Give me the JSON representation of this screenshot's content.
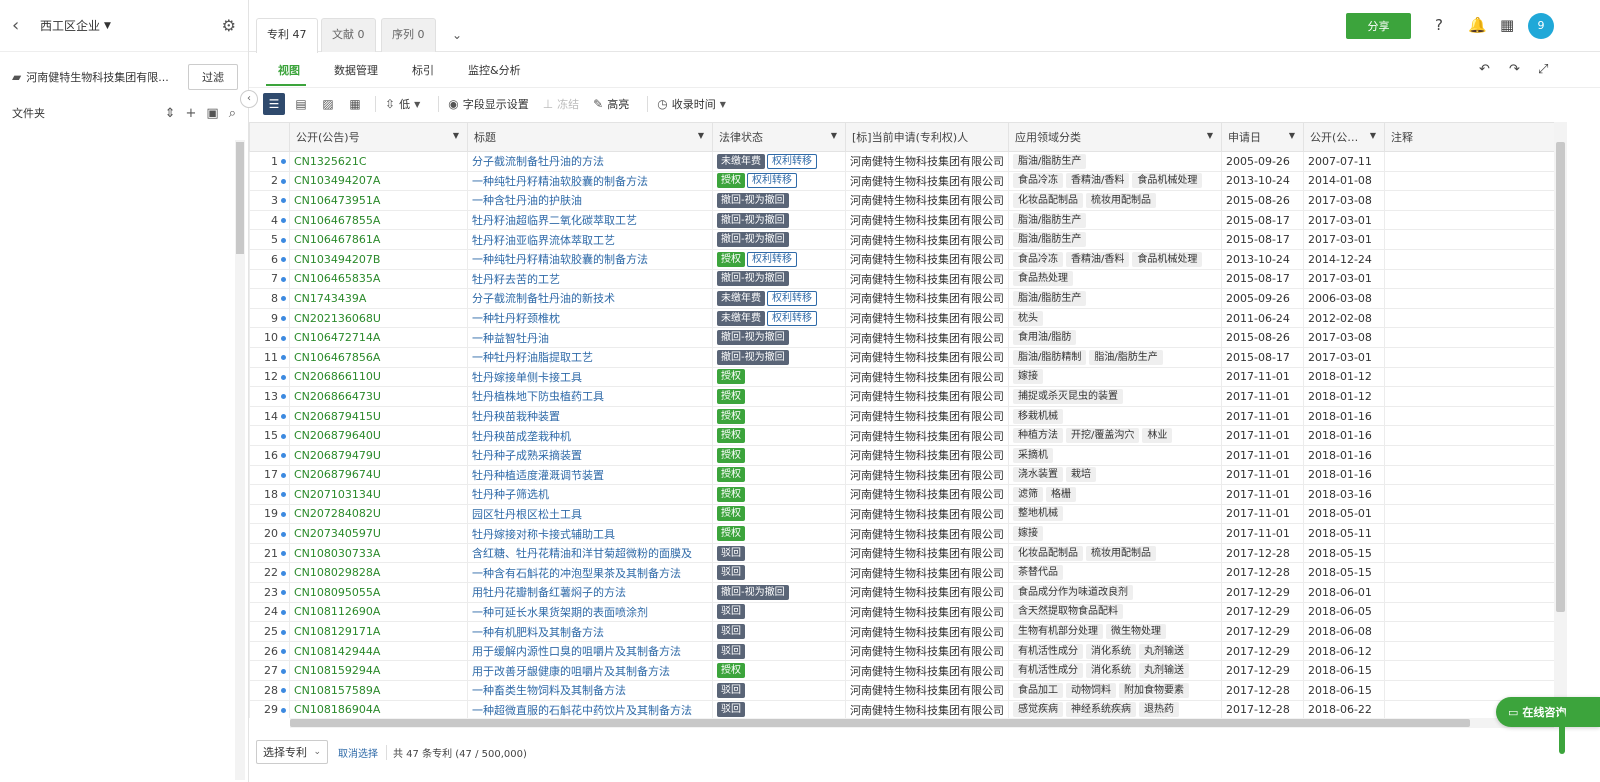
{
  "sidebar": {
    "workspace": "西工区企业",
    "project_name": "河南健特生物科技集团有限...",
    "filter_label": "过滤",
    "folder_label": "文件夹"
  },
  "tabs": [
    {
      "label": "专利 47",
      "active": true
    },
    {
      "label": "文献 0",
      "active": false
    },
    {
      "label": "序列 0",
      "active": false
    }
  ],
  "header": {
    "share_label": "分享",
    "avatar": "9"
  },
  "subnav": [
    {
      "label": "视图",
      "active": true
    },
    {
      "label": "数据管理",
      "active": false
    },
    {
      "label": "标引",
      "active": false
    },
    {
      "label": "监控&分析",
      "active": false
    }
  ],
  "toolbar": {
    "density_label": "低",
    "fields_label": "字段显示设置",
    "freeze_label": "冻结",
    "highlight_label": "高亮",
    "time_label": "收录时间"
  },
  "columns": [
    "公开(公告)号",
    "标题",
    "法律状态",
    "[标]当前申请(专利权)人",
    "应用领域分类",
    "申请日",
    "公开(公…",
    "注释"
  ],
  "rows": [
    {
      "n": "1",
      "pn": "CN1325621C",
      "title": "分子截流制备牡丹油的方法",
      "status": [
        [
          "未缴年费",
          "gray"
        ],
        [
          "权利转移",
          "outline"
        ]
      ],
      "app": "河南健特生物科技集团有限公司",
      "cats": [
        "脂油/脂肪生产"
      ],
      "ad": "2005-09-26",
      "pd": "2007-07-11"
    },
    {
      "n": "2",
      "pn": "CN103494207A",
      "title": "一种纯牡丹籽精油软胶囊的制备方法",
      "status": [
        [
          "授权",
          "green"
        ],
        [
          "权利转移",
          "outline"
        ]
      ],
      "app": "河南健特生物科技集团有限公司",
      "cats": [
        "食品冷冻",
        "香精油/香料",
        "食品机械处理"
      ],
      "ad": "2013-10-24",
      "pd": "2014-01-08"
    },
    {
      "n": "3",
      "pn": "CN106473951A",
      "title": "一种含牡丹油的护肤油",
      "status": [
        [
          "撤回-视为撤回",
          "gray"
        ]
      ],
      "app": "河南健特生物科技集团有限公司",
      "cats": [
        "化妆品配制品",
        "梳妆用配制品"
      ],
      "ad": "2015-08-26",
      "pd": "2017-03-08"
    },
    {
      "n": "4",
      "pn": "CN106467855A",
      "title": "牡丹籽油超临界二氧化碳萃取工艺",
      "status": [
        [
          "撤回-视为撤回",
          "gray"
        ]
      ],
      "app": "河南健特生物科技集团有限公司",
      "cats": [
        "脂油/脂肪生产"
      ],
      "ad": "2015-08-17",
      "pd": "2017-03-01"
    },
    {
      "n": "5",
      "pn": "CN106467861A",
      "title": "牡丹籽油亚临界流体萃取工艺",
      "status": [
        [
          "撤回-视为撤回",
          "gray"
        ]
      ],
      "app": "河南健特生物科技集团有限公司",
      "cats": [
        "脂油/脂肪生产"
      ],
      "ad": "2015-08-17",
      "pd": "2017-03-01"
    },
    {
      "n": "6",
      "pn": "CN103494207B",
      "title": "一种纯牡丹籽精油软胶囊的制备方法",
      "status": [
        [
          "授权",
          "green"
        ],
        [
          "权利转移",
          "outline"
        ]
      ],
      "app": "河南健特生物科技集团有限公司",
      "cats": [
        "食品冷冻",
        "香精油/香料",
        "食品机械处理"
      ],
      "ad": "2013-10-24",
      "pd": "2014-12-24"
    },
    {
      "n": "7",
      "pn": "CN106465835A",
      "title": "牡丹籽去苦的工艺",
      "status": [
        [
          "撤回-视为撤回",
          "gray"
        ]
      ],
      "app": "河南健特生物科技集团有限公司",
      "cats": [
        "食品热处理"
      ],
      "ad": "2015-08-17",
      "pd": "2017-03-01"
    },
    {
      "n": "8",
      "pn": "CN1743439A",
      "title": "分子截流制备牡丹油的新技术",
      "status": [
        [
          "未缴年费",
          "gray"
        ],
        [
          "权利转移",
          "outline"
        ]
      ],
      "app": "河南健特生物科技集团有限公司",
      "cats": [
        "脂油/脂肪生产"
      ],
      "ad": "2005-09-26",
      "pd": "2006-03-08"
    },
    {
      "n": "9",
      "pn": "CN202136068U",
      "title": "一种牡丹籽颈椎枕",
      "status": [
        [
          "未缴年费",
          "gray"
        ],
        [
          "权利转移",
          "outline"
        ]
      ],
      "app": "河南健特生物科技集团有限公司",
      "cats": [
        "枕头"
      ],
      "ad": "2011-06-24",
      "pd": "2012-02-08"
    },
    {
      "n": "10",
      "pn": "CN106472714A",
      "title": "一种益智牡丹油",
      "status": [
        [
          "撤回-视为撤回",
          "gray"
        ]
      ],
      "app": "河南健特生物科技集团有限公司",
      "cats": [
        "食用油/脂肪"
      ],
      "ad": "2015-08-26",
      "pd": "2017-03-08"
    },
    {
      "n": "11",
      "pn": "CN106467856A",
      "title": "一种牡丹籽油脂提取工艺",
      "status": [
        [
          "撤回-视为撤回",
          "gray"
        ]
      ],
      "app": "河南健特生物科技集团有限公司",
      "cats": [
        "脂油/脂肪精制",
        "脂油/脂肪生产"
      ],
      "ad": "2015-08-17",
      "pd": "2017-03-01"
    },
    {
      "n": "12",
      "pn": "CN206866110U",
      "title": "牡丹嫁接单侧卡接工具",
      "status": [
        [
          "授权",
          "green"
        ]
      ],
      "app": "河南健特生物科技集团有限公司",
      "cats": [
        "嫁接"
      ],
      "ad": "2017-11-01",
      "pd": "2018-01-12"
    },
    {
      "n": "13",
      "pn": "CN206866473U",
      "title": "牡丹植株地下防虫植药工具",
      "status": [
        [
          "授权",
          "green"
        ]
      ],
      "app": "河南健特生物科技集团有限公司",
      "cats": [
        "捕捉或杀灭昆虫的装置"
      ],
      "ad": "2017-11-01",
      "pd": "2018-01-12"
    },
    {
      "n": "14",
      "pn": "CN206879415U",
      "title": "牡丹秧苗栽种装置",
      "status": [
        [
          "授权",
          "green"
        ]
      ],
      "app": "河南健特生物科技集团有限公司",
      "cats": [
        "移栽机械"
      ],
      "ad": "2017-11-01",
      "pd": "2018-01-16"
    },
    {
      "n": "15",
      "pn": "CN206879640U",
      "title": "牡丹秧苗成垄栽种机",
      "status": [
        [
          "授权",
          "green"
        ]
      ],
      "app": "河南健特生物科技集团有限公司",
      "cats": [
        "种植方法",
        "开挖/覆盖沟穴",
        "林业"
      ],
      "ad": "2017-11-01",
      "pd": "2018-01-16"
    },
    {
      "n": "16",
      "pn": "CN206879479U",
      "title": "牡丹种子成熟采摘装置",
      "status": [
        [
          "授权",
          "green"
        ]
      ],
      "app": "河南健特生物科技集团有限公司",
      "cats": [
        "采摘机"
      ],
      "ad": "2017-11-01",
      "pd": "2018-01-16"
    },
    {
      "n": "17",
      "pn": "CN206879674U",
      "title": "牡丹种植适度灌溉调节装置",
      "status": [
        [
          "授权",
          "green"
        ]
      ],
      "app": "河南健特生物科技集团有限公司",
      "cats": [
        "浇水装置",
        "栽培"
      ],
      "ad": "2017-11-01",
      "pd": "2018-01-16"
    },
    {
      "n": "18",
      "pn": "CN207103134U",
      "title": "牡丹种子筛选机",
      "status": [
        [
          "授权",
          "green"
        ]
      ],
      "app": "河南健特生物科技集团有限公司",
      "cats": [
        "滤筛",
        "格栅"
      ],
      "ad": "2017-11-01",
      "pd": "2018-03-16"
    },
    {
      "n": "19",
      "pn": "CN207284082U",
      "title": "园区牡丹根区松土工具",
      "status": [
        [
          "授权",
          "green"
        ]
      ],
      "app": "河南健特生物科技集团有限公司",
      "cats": [
        "整地机械"
      ],
      "ad": "2017-11-01",
      "pd": "2018-05-01"
    },
    {
      "n": "20",
      "pn": "CN207340597U",
      "title": "牡丹嫁接对称卡接式辅助工具",
      "status": [
        [
          "授权",
          "green"
        ]
      ],
      "app": "河南健特生物科技集团有限公司",
      "cats": [
        "嫁接"
      ],
      "ad": "2017-11-01",
      "pd": "2018-05-11"
    },
    {
      "n": "21",
      "pn": "CN108030733A",
      "title": "含红糖、牡丹花精油和洋甘菊超微粉的面膜及",
      "status": [
        [
          "驳回",
          "gray"
        ]
      ],
      "app": "河南健特生物科技集团有限公司",
      "cats": [
        "化妆品配制品",
        "梳妆用配制品"
      ],
      "ad": "2017-12-28",
      "pd": "2018-05-15"
    },
    {
      "n": "22",
      "pn": "CN108029828A",
      "title": "一种含有石斛花的冲泡型果茶及其制备方法",
      "status": [
        [
          "驳回",
          "gray"
        ]
      ],
      "app": "河南健特生物科技集团有限公司",
      "cats": [
        "茶替代品"
      ],
      "ad": "2017-12-28",
      "pd": "2018-05-15"
    },
    {
      "n": "23",
      "pn": "CN108095055A",
      "title": "用牡丹花瓣制备红薯焖子的方法",
      "status": [
        [
          "撤回-视为撤回",
          "gray"
        ]
      ],
      "app": "河南健特生物科技集团有限公司",
      "cats": [
        "食品成分作为味道改良剂"
      ],
      "ad": "2017-12-29",
      "pd": "2018-06-01"
    },
    {
      "n": "24",
      "pn": "CN108112690A",
      "title": "一种可延长水果货架期的表面喷涂剂",
      "status": [
        [
          "驳回",
          "gray"
        ]
      ],
      "app": "河南健特生物科技集团有限公司",
      "cats": [
        "含天然提取物食品配料"
      ],
      "ad": "2017-12-29",
      "pd": "2018-06-05"
    },
    {
      "n": "25",
      "pn": "CN108129171A",
      "title": "一种有机肥料及其制备方法",
      "status": [
        [
          "驳回",
          "gray"
        ]
      ],
      "app": "河南健特生物科技集团有限公司",
      "cats": [
        "生物有机部分处理",
        "微生物处理"
      ],
      "ad": "2017-12-29",
      "pd": "2018-06-08"
    },
    {
      "n": "26",
      "pn": "CN108142944A",
      "title": "用于缓解内源性口臭的咀嚼片及其制备方法",
      "status": [
        [
          "驳回",
          "gray"
        ]
      ],
      "app": "河南健特生物科技集团有限公司",
      "cats": [
        "有机活性成分",
        "消化系统",
        "丸剂输送"
      ],
      "ad": "2017-12-29",
      "pd": "2018-06-12"
    },
    {
      "n": "27",
      "pn": "CN108159294A",
      "title": "用于改善牙龈健康的咀嚼片及其制备方法",
      "status": [
        [
          "授权",
          "green"
        ]
      ],
      "app": "河南健特生物科技集团有限公司",
      "cats": [
        "有机活性成分",
        "消化系统",
        "丸剂输送"
      ],
      "ad": "2017-12-29",
      "pd": "2018-06-15"
    },
    {
      "n": "28",
      "pn": "CN108157589A",
      "title": "一种畜类生物饲料及其制备方法",
      "status": [
        [
          "驳回",
          "gray"
        ]
      ],
      "app": "河南健特生物科技集团有限公司",
      "cats": [
        "食品加工",
        "动物饲料",
        "附加食物要素"
      ],
      "ad": "2017-12-28",
      "pd": "2018-06-15"
    },
    {
      "n": "29",
      "pn": "CN108186904A",
      "title": "一种超微直服的石斛花中药饮片及其制备方法",
      "status": [
        [
          "驳回",
          "gray"
        ]
      ],
      "app": "河南健特生物科技集团有限公司",
      "cats": [
        "感觉疾病",
        "神经系统疾病",
        "退热药"
      ],
      "ad": "2017-12-28",
      "pd": "2018-06-22"
    }
  ],
  "footer": {
    "select_label": "选择专利",
    "cancel_label": "取消选择",
    "count_text": "共 47 条专利 (47 / 500,000)"
  },
  "chat_label": "在线咨询"
}
